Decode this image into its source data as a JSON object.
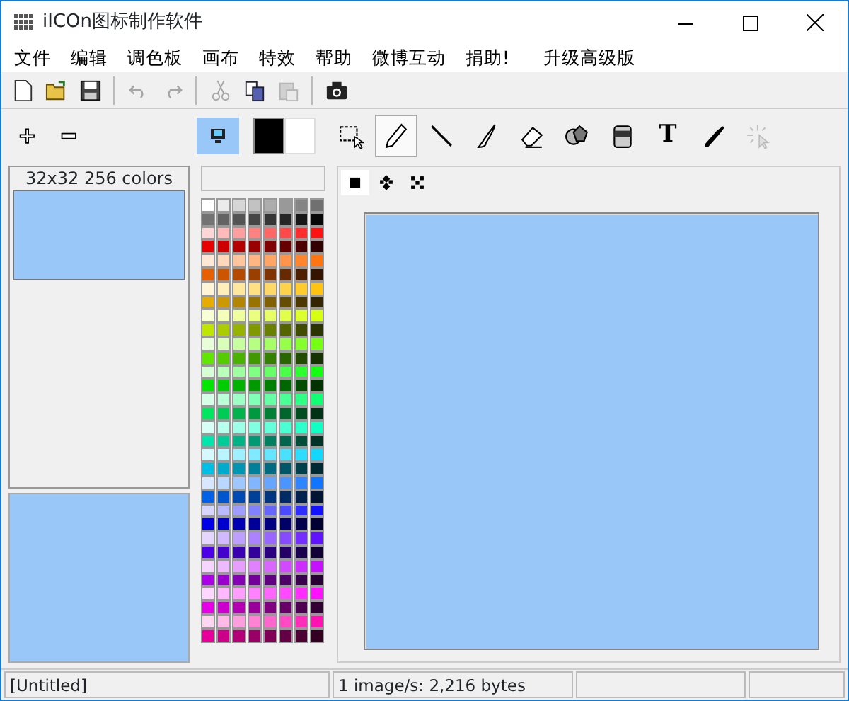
{
  "window": {
    "title": "iICOn图标制作软件"
  },
  "menu": [
    "文件",
    "编辑",
    "调色板",
    "画布",
    "特效",
    "帮助",
    "微博互动",
    "捐助!",
    "升级高级版"
  ],
  "toolbar": [
    {
      "kind": "new",
      "disabled": false
    },
    {
      "kind": "open",
      "disabled": false
    },
    {
      "kind": "save",
      "disabled": false
    },
    {
      "kind": "sep"
    },
    {
      "kind": "undo",
      "disabled": true
    },
    {
      "kind": "redo",
      "disabled": true
    },
    {
      "kind": "sep"
    },
    {
      "kind": "cut",
      "disabled": true
    },
    {
      "kind": "copy",
      "disabled": false
    },
    {
      "kind": "paste",
      "disabled": true
    },
    {
      "kind": "sep"
    },
    {
      "kind": "camera",
      "disabled": false
    }
  ],
  "zoom_buttons": [
    {
      "kind": "plus"
    },
    {
      "kind": "minus"
    }
  ],
  "icon_formats": [
    {
      "label": "32x32 256 colors",
      "selected": true
    }
  ],
  "tools": [
    {
      "kind": "select",
      "selected": false,
      "disabled": false
    },
    {
      "kind": "pencil",
      "selected": true,
      "disabled": false
    },
    {
      "kind": "line",
      "selected": false,
      "disabled": false
    },
    {
      "kind": "brush",
      "selected": false,
      "disabled": false
    },
    {
      "kind": "eraser",
      "selected": false,
      "disabled": false
    },
    {
      "kind": "shapes",
      "selected": false,
      "disabled": false
    },
    {
      "kind": "fill",
      "selected": false,
      "disabled": false
    },
    {
      "kind": "text",
      "label": "T",
      "selected": false,
      "disabled": false
    },
    {
      "kind": "picker",
      "selected": false,
      "disabled": false
    },
    {
      "kind": "magic",
      "selected": false,
      "disabled": true
    }
  ],
  "brush_shapes": [
    {
      "kind": "square",
      "selected": true
    },
    {
      "kind": "diamond",
      "selected": false
    },
    {
      "kind": "cross",
      "selected": false
    }
  ],
  "status_bar": [
    "[Untitled]",
    "1 image/s: 2,216 bytes"
  ]
}
